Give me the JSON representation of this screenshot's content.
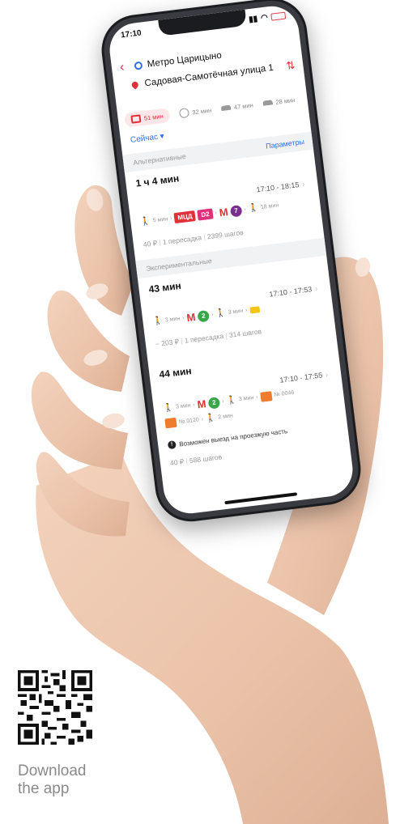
{
  "phone": {
    "status_time": "17:10",
    "origin": "Метро Царицыно",
    "destination": "Садовая-Самотёчная улица 1",
    "modes": [
      {
        "icon": "bus-icon",
        "label": "51 мин",
        "active": true
      },
      {
        "icon": "bike-icon",
        "label": "32 мин",
        "active": false
      },
      {
        "icon": "car-icon",
        "label": "47 мин",
        "active": false
      },
      {
        "icon": "taxi-icon",
        "label": "28 мин",
        "active": false
      }
    ],
    "departure": "Сейчас ▾",
    "sections": {
      "alternative": "Альтернативные",
      "params": "Параметры",
      "experimental": "Экспериментальные"
    },
    "routes": [
      {
        "duration": "1 ч 4 мин",
        "time": "17:10 - 18:15",
        "walk1": "5 мин",
        "tag1": "МЦД",
        "tag2": "D2",
        "line": "7",
        "walk2": "18 мин",
        "price": "40 ₽",
        "transfers": "1 пересадка",
        "steps_count": "2399 шагов"
      },
      {
        "duration": "43 мин",
        "time": "17:10 - 17:53",
        "walk1": "3 мин",
        "line": "2",
        "walk2": "3 мин",
        "price": "~ 203 ₽",
        "transfers": "1 пересадка",
        "steps_count": "314 шагов"
      },
      {
        "duration": "44 мин",
        "time": "17:10 - 17:55",
        "walk1": "3 мин",
        "line": "2",
        "walk2": "3 мин",
        "bike1": "№ 0046",
        "bike2": "№ 0120",
        "walk3": "2 мин",
        "warning": "Возможен выезд на проезжую часть",
        "price": "40 ₽",
        "steps_count": "588 шагов"
      }
    ]
  },
  "download": {
    "line1": "Download",
    "line2": "the app"
  },
  "colors": {
    "accent_red": "#e0303a",
    "link_blue": "#2f6fe0",
    "line_purple": "#7a2e8f",
    "line_green": "#3aa64a"
  }
}
